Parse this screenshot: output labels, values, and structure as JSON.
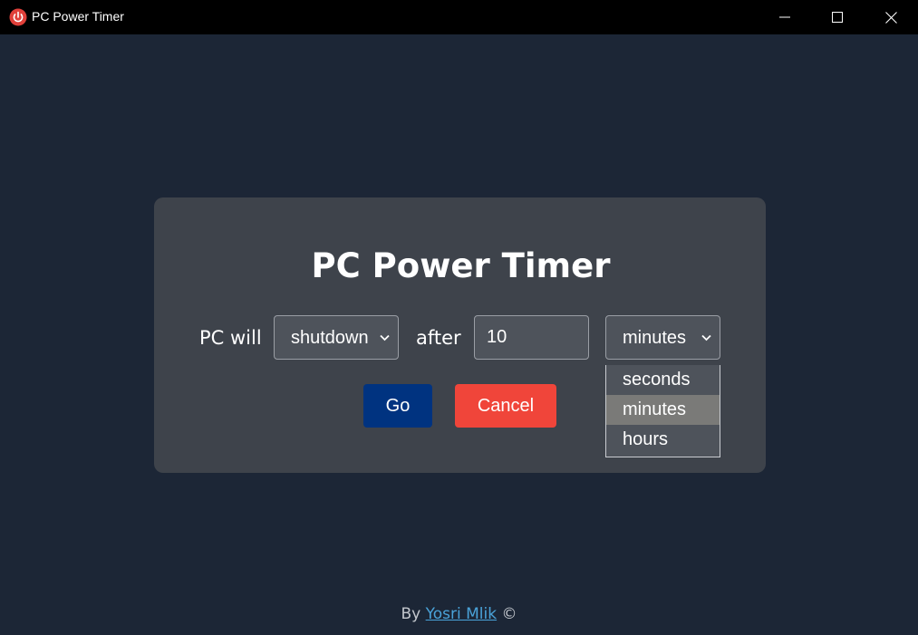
{
  "window": {
    "title": "PC Power Timer",
    "icon": "power-icon"
  },
  "card": {
    "heading": "PC Power Timer",
    "pc_will_label": "PC will",
    "action_select_value": "shutdown",
    "after_label": "after",
    "time_value": "10",
    "unit_select_value": "minutes",
    "go_label": "Go",
    "cancel_label": "Cancel"
  },
  "unit_dropdown": {
    "options": [
      "seconds",
      "minutes",
      "hours"
    ],
    "highlighted": "minutes"
  },
  "footer": {
    "prefix": "By",
    "author": "Yosri Mlik",
    "suffix": "©"
  },
  "colors": {
    "background": "#1c2636",
    "card": "#3e434b",
    "go_button": "#003380",
    "cancel_button": "#f0453a",
    "link": "#4aa3d9",
    "icon_red": "#e0403a"
  }
}
